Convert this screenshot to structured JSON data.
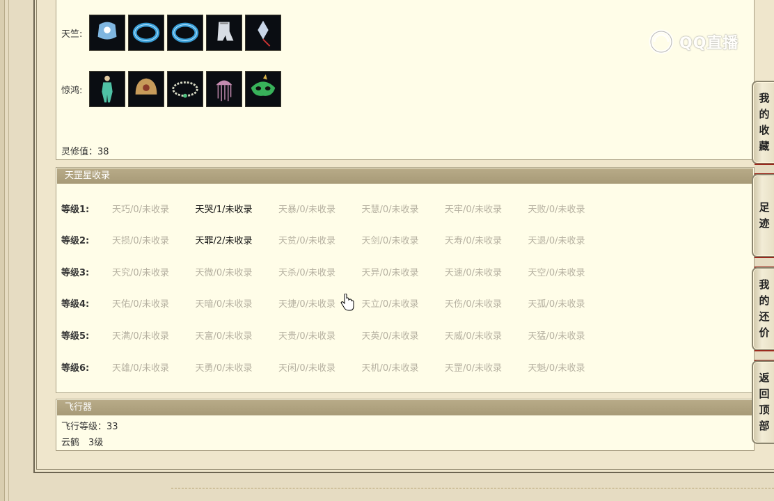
{
  "equipment": {
    "rows": [
      {
        "label": "天竺:",
        "items": [
          {
            "icon": "armor-icon",
            "color": "#7fb6e0"
          },
          {
            "icon": "bracelet-icon",
            "color": "#3a9fd8"
          },
          {
            "icon": "bracelet-icon",
            "color": "#3a9fd8"
          },
          {
            "icon": "glove-icon",
            "color": "#d8dde4"
          },
          {
            "icon": "pendant-icon",
            "color": "#c9d6e8"
          }
        ]
      },
      {
        "label": "惊鸿:",
        "items": [
          {
            "icon": "figure-icon",
            "color": "#4fc2a5"
          },
          {
            "icon": "helmet-icon",
            "color": "#c79b5a"
          },
          {
            "icon": "necklace-icon",
            "color": "#d7d9c4"
          },
          {
            "icon": "jellyfish-icon",
            "color": "#c48bb0"
          },
          {
            "icon": "mask-icon",
            "color": "#38b25a"
          }
        ]
      }
    ],
    "lingxiu_label": "灵修值：",
    "lingxiu_value": "38"
  },
  "tiangang": {
    "title": "天罡星收录",
    "grades": [
      {
        "label": "等级1:",
        "cells": [
          {
            "text": "天巧/0/未收录",
            "have": false
          },
          {
            "text": "天哭/1/未收录",
            "have": true
          },
          {
            "text": "天暴/0/未收录",
            "have": false
          },
          {
            "text": "天慧/0/未收录",
            "have": false
          },
          {
            "text": "天牢/0/未收录",
            "have": false
          },
          {
            "text": "天败/0/未收录",
            "have": false
          }
        ]
      },
      {
        "label": "等级2:",
        "cells": [
          {
            "text": "天损/0/未收录",
            "have": false
          },
          {
            "text": "天罪/2/未收录",
            "have": true
          },
          {
            "text": "天贫/0/未收录",
            "have": false
          },
          {
            "text": "天剑/0/未收录",
            "have": false
          },
          {
            "text": "天寿/0/未收录",
            "have": false
          },
          {
            "text": "天退/0/未收录",
            "have": false
          }
        ]
      },
      {
        "label": "等级3:",
        "cells": [
          {
            "text": "天究/0/未收录",
            "have": false
          },
          {
            "text": "天微/0/未收录",
            "have": false
          },
          {
            "text": "天杀/0/未收录",
            "have": false
          },
          {
            "text": "天异/0/未收录",
            "have": false
          },
          {
            "text": "天速/0/未收录",
            "have": false
          },
          {
            "text": "天空/0/未收录",
            "have": false
          }
        ]
      },
      {
        "label": "等级4:",
        "cells": [
          {
            "text": "天佑/0/未收录",
            "have": false
          },
          {
            "text": "天暗/0/未收录",
            "have": false
          },
          {
            "text": "天捷/0/未收录",
            "have": false
          },
          {
            "text": "天立/0/未收录",
            "have": false
          },
          {
            "text": "天伤/0/未收录",
            "have": false
          },
          {
            "text": "天孤/0/未收录",
            "have": false
          }
        ]
      },
      {
        "label": "等级5:",
        "cells": [
          {
            "text": "天满/0/未收录",
            "have": false
          },
          {
            "text": "天富/0/未收录",
            "have": false
          },
          {
            "text": "天贵/0/未收录",
            "have": false
          },
          {
            "text": "天英/0/未收录",
            "have": false
          },
          {
            "text": "天威/0/未收录",
            "have": false
          },
          {
            "text": "天猛/0/未收录",
            "have": false
          }
        ]
      },
      {
        "label": "等级6:",
        "cells": [
          {
            "text": "天雄/0/未收录",
            "have": false
          },
          {
            "text": "天勇/0/未收录",
            "have": false
          },
          {
            "text": "天闲/0/未收录",
            "have": false
          },
          {
            "text": "天机/0/未收录",
            "have": false
          },
          {
            "text": "天罡/0/未收录",
            "have": false
          },
          {
            "text": "天魁/0/未收录",
            "have": false
          }
        ]
      }
    ]
  },
  "flyer": {
    "title": "飞行器",
    "level_line": "飞行等级：33",
    "mount_line": "云鹤　3级"
  },
  "side": {
    "favorites": "我的收藏",
    "footprint": "足迹",
    "bargain": "我的还价",
    "back_top": "返回顶部"
  },
  "watermark": {
    "text": "QQ直播"
  },
  "colors": {
    "have": "#111111",
    "missing": "#b5b0a0",
    "header": "#ad9f7c"
  }
}
